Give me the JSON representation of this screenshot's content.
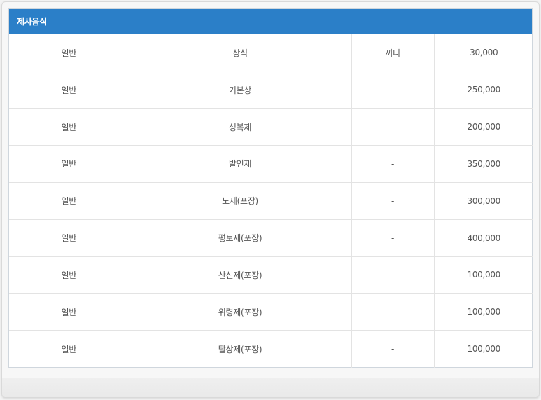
{
  "panel": {
    "title": "제사음식"
  },
  "table": {
    "rows": [
      {
        "type": "일반",
        "name": "상식",
        "note": "끼니",
        "price": "30,000"
      },
      {
        "type": "일반",
        "name": "기본상",
        "note": "-",
        "price": "250,000"
      },
      {
        "type": "일반",
        "name": "성복제",
        "note": "-",
        "price": "200,000"
      },
      {
        "type": "일반",
        "name": "발인제",
        "note": "-",
        "price": "350,000"
      },
      {
        "type": "일반",
        "name": "노제(포장)",
        "note": "-",
        "price": "300,000"
      },
      {
        "type": "일반",
        "name": "평토제(포장)",
        "note": "-",
        "price": "400,000"
      },
      {
        "type": "일반",
        "name": "산신제(포장)",
        "note": "-",
        "price": "100,000"
      },
      {
        "type": "일반",
        "name": "위령제(포장)",
        "note": "-",
        "price": "100,000"
      },
      {
        "type": "일반",
        "name": "탈상제(포장)",
        "note": "-",
        "price": "100,000"
      }
    ]
  },
  "colors": {
    "header_bg": "#2b7fc8",
    "header_text": "#ffffff",
    "cell_text": "#555555",
    "border": "#e3e3e3"
  }
}
